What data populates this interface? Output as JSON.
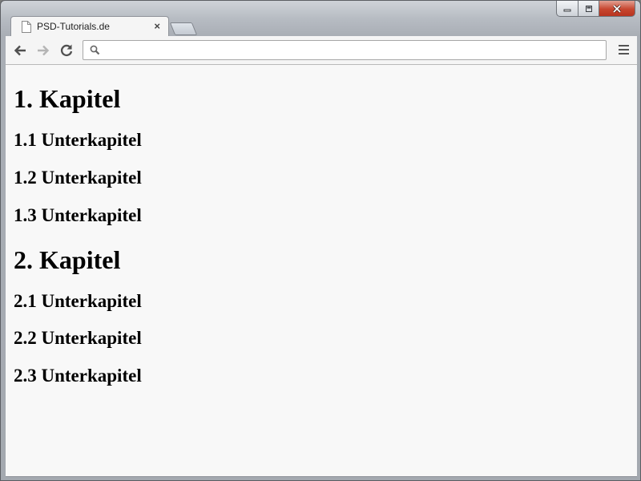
{
  "browser": {
    "tab": {
      "title": "PSD-Tutorials.de",
      "close_glyph": "×",
      "favicon": "page-icon"
    },
    "new_tab": "new-tab-button",
    "omnibox": {
      "value": "",
      "icon": "search-icon"
    },
    "window_controls": [
      "minimize-icon",
      "maximize-icon",
      "close-icon"
    ]
  },
  "content": {
    "headings": [
      {
        "level": 1,
        "text": "1. Kapitel"
      },
      {
        "level": 2,
        "text": "1.1 Unterkapitel"
      },
      {
        "level": 2,
        "text": "1.2 Unterkapitel"
      },
      {
        "level": 2,
        "text": "1.3 Unterkapitel"
      },
      {
        "level": 1,
        "text": "2. Kapitel"
      },
      {
        "level": 2,
        "text": "2.1 Unterkapitel"
      },
      {
        "level": 2,
        "text": "2.2 Unterkapitel"
      },
      {
        "level": 2,
        "text": "2.3 Unterkapitel"
      }
    ]
  }
}
